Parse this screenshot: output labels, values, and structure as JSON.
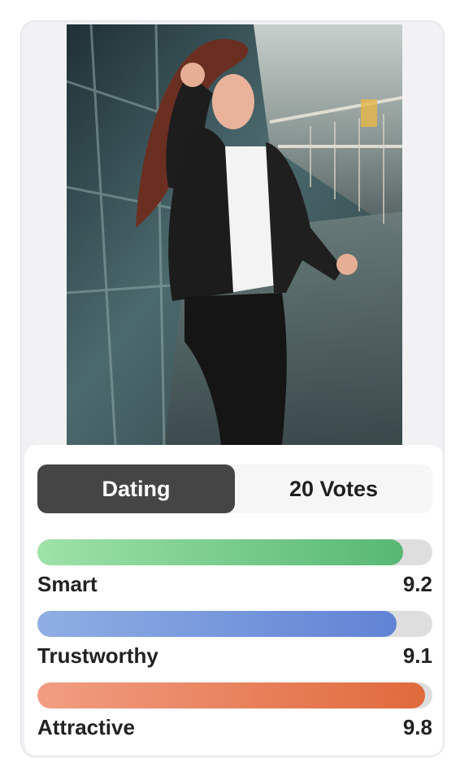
{
  "tabs": {
    "active_label": "Dating",
    "votes_label": "20 Votes"
  },
  "metrics": [
    {
      "label": "Smart",
      "value": "9.2",
      "fraction": 0.925,
      "color_start": "#9ee2a8",
      "color_end": "#57b873"
    },
    {
      "label": "Trustworthy",
      "value": "9.1",
      "fraction": 0.91,
      "color_start": "#8eaee4",
      "color_end": "#6183d4"
    },
    {
      "label": "Attractive",
      "value": "9.8",
      "fraction": 0.982,
      "color_start": "#f19d82",
      "color_end": "#e06a3c"
    }
  ],
  "photo": {
    "subject": "woman-in-black-leather-jacket-on-glass-bridge"
  }
}
